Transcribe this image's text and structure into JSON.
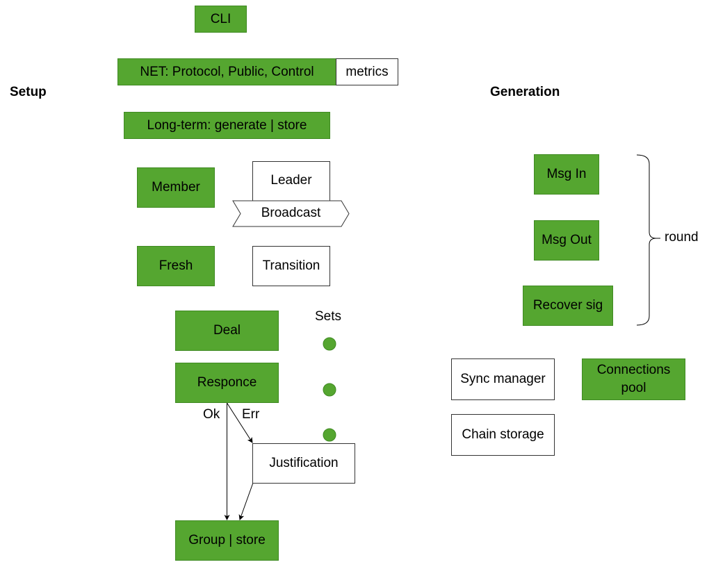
{
  "sections": {
    "setup": "Setup",
    "generation": "Generation"
  },
  "setup": {
    "cli": "CLI",
    "net": "NET: Protocol, Public, Control",
    "metrics": "metrics",
    "long_term": "Long-term: generate | store",
    "member": "Member",
    "leader": "Leader",
    "broadcast": "Broadcast",
    "fresh": "Fresh",
    "transition": "Transition",
    "deal": "Deal",
    "responce": "Responce",
    "justification": "Justification",
    "group_store": "Group | store",
    "sets_label": "Sets",
    "ok_label": "Ok",
    "err_label": "Err",
    "set_dots": 3
  },
  "generation": {
    "msg_in": "Msg In",
    "msg_out": "Msg Out",
    "recover_sig": "Recover sig",
    "round_label": "round",
    "sync_manager": "Sync manager",
    "connections_pool": "Connections pool",
    "chain_storage": "Chain storage"
  },
  "colors": {
    "component_fill": "#55a630",
    "component_border": "#3f8a22",
    "stroke": "#000000"
  }
}
